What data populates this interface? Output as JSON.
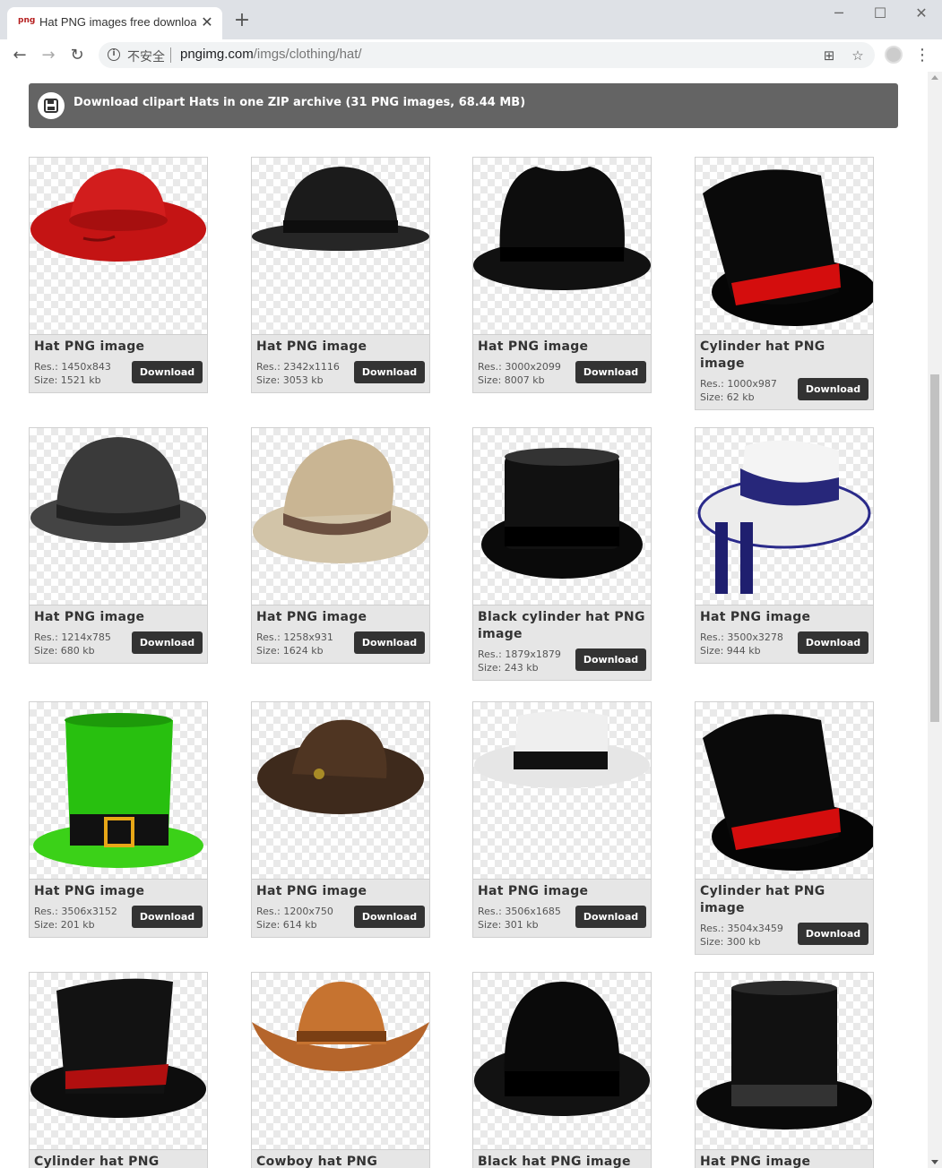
{
  "browser": {
    "tab_title": "Hat PNG images free download",
    "favicon_text": "png",
    "security_label": "不安全",
    "url_host": "pngimg.com",
    "url_path": "/imgs/clothing/hat/"
  },
  "zip_banner": {
    "text": "Download clipart Hats in one ZIP archive (31 PNG images, 68.44 MB)"
  },
  "download_label": "Download",
  "cards": [
    {
      "title": "Hat PNG image",
      "res": "Res.: 1450x843",
      "size": "Size: 1521 kb",
      "hat": "red-sun-hat"
    },
    {
      "title": "Hat PNG image",
      "res": "Res.: 2342x1116",
      "size": "Size: 3053 kb",
      "hat": "black-bowler"
    },
    {
      "title": "Hat PNG image",
      "res": "Res.: 3000x2099",
      "size": "Size: 8007 kb",
      "hat": "black-fedora"
    },
    {
      "title": "Cylinder hat PNG image",
      "res": "Res.: 1000x987",
      "size": "Size: 62 kb",
      "hat": "top-hat-red-band"
    },
    {
      "title": "Hat PNG image",
      "res": "Res.: 1214x785",
      "size": "Size: 680 kb",
      "hat": "grey-bowler"
    },
    {
      "title": "Hat PNG image",
      "res": "Res.: 1258x931",
      "size": "Size: 1624 kb",
      "hat": "khaki-outback"
    },
    {
      "title": "Black cylinder hat PNG image",
      "res": "Res.: 1879x1879",
      "size": "Size: 243 kb",
      "hat": "black-top-hat"
    },
    {
      "title": "Hat PNG image",
      "res": "Res.: 3500x3278",
      "size": "Size: 944 kb",
      "hat": "white-boater"
    },
    {
      "title": "Hat PNG image",
      "res": "Res.: 3506x3152",
      "size": "Size: 201 kb",
      "hat": "green-leprechaun"
    },
    {
      "title": "Hat PNG image",
      "res": "Res.: 1200x750",
      "size": "Size: 614 kb",
      "hat": "brown-ranger"
    },
    {
      "title": "Hat PNG image",
      "res": "Res.: 3506x1685",
      "size": "Size: 301 kb",
      "hat": "white-panama"
    },
    {
      "title": "Cylinder hat PNG image",
      "res": "Res.: 3504x3459",
      "size": "Size: 300 kb",
      "hat": "top-hat-red-band"
    },
    {
      "title": "Cylinder hat PNG image",
      "res": "",
      "size": "",
      "hat": "glossy-top-hat"
    },
    {
      "title": "Cowboy hat PNG image",
      "res": "",
      "size": "",
      "hat": "cowboy"
    },
    {
      "title": "Black hat PNG image",
      "res": "",
      "size": "",
      "hat": "black-derby"
    },
    {
      "title": "Hat PNG image",
      "res": "",
      "size": "",
      "hat": "black-top-hat-2"
    }
  ]
}
